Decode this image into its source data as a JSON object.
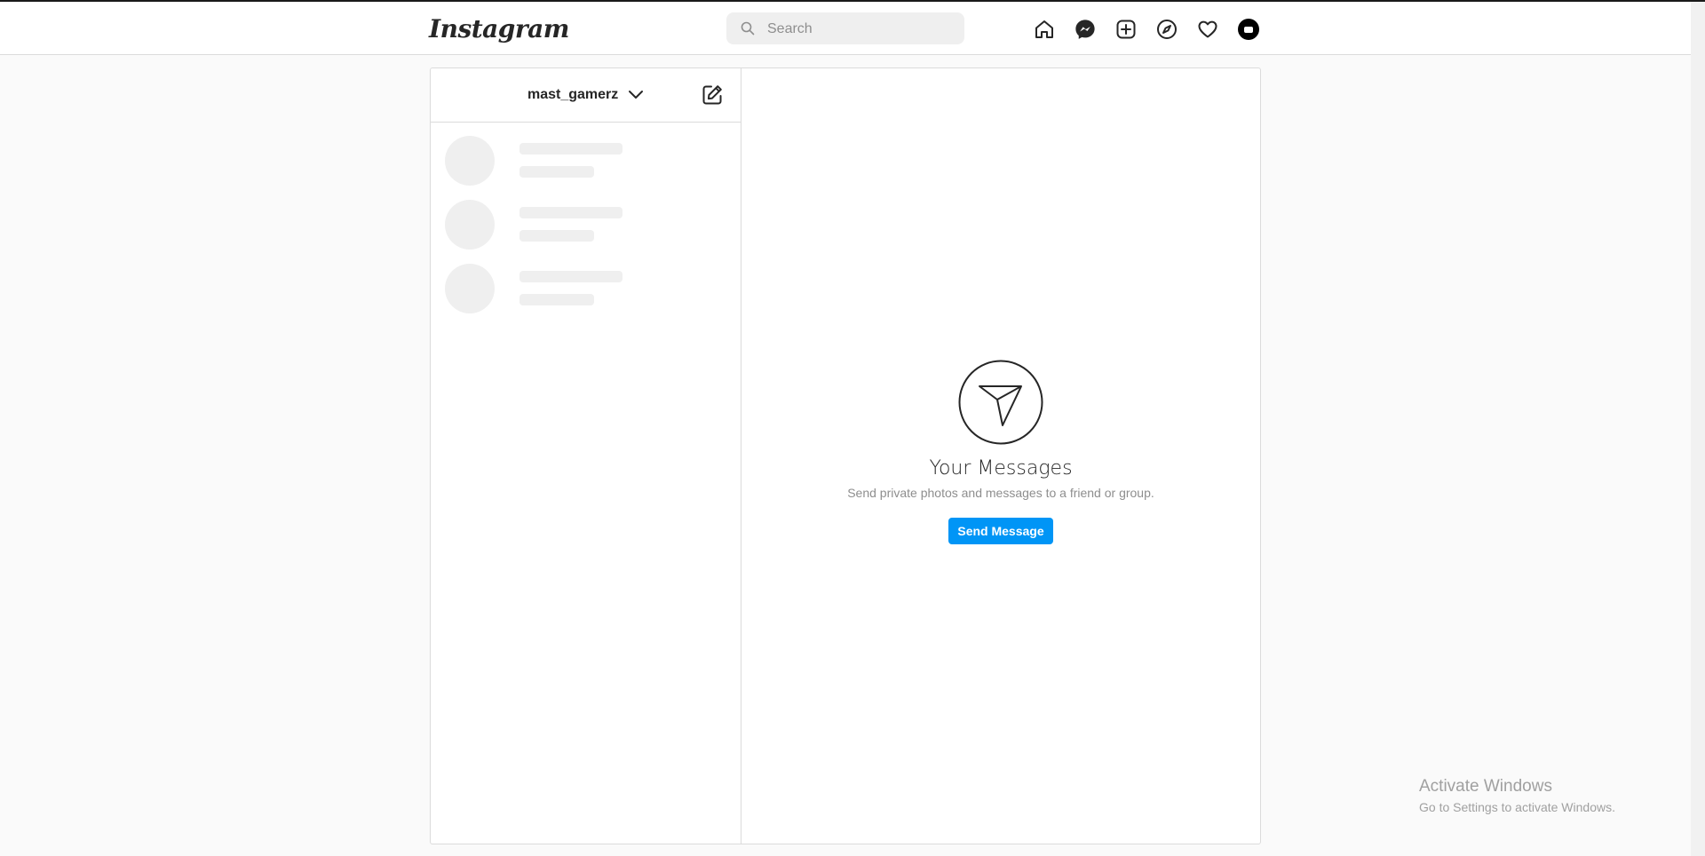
{
  "navbar": {
    "logo": "Instagram",
    "search_placeholder": "Search",
    "icons": [
      "home-icon",
      "messenger-icon",
      "new-post-icon",
      "explore-icon",
      "activity-heart-icon",
      "profile-avatar"
    ]
  },
  "inbox": {
    "account_name": "mast_gamerz"
  },
  "empty_state": {
    "title": "Your Messages",
    "subtitle": "Send private photos and messages to a friend or group.",
    "button_label": "Send Message"
  },
  "colors": {
    "accent": "#0095f6",
    "border": "#dbdbdb",
    "background": "#fafafa",
    "skeleton": "#efefef"
  },
  "watermark": {
    "line1": "Activate Windows",
    "line2": "Go to Settings to activate Windows."
  }
}
